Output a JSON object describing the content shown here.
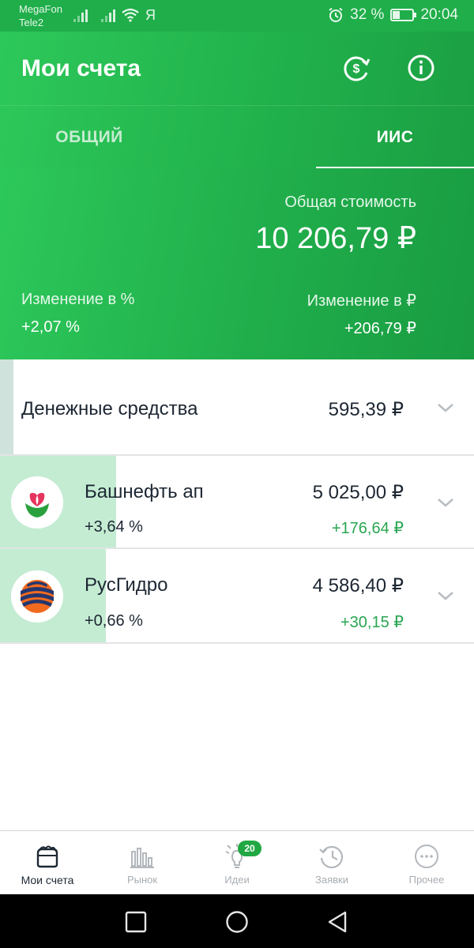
{
  "status_bar": {
    "carrier_1": "MegaFon",
    "carrier_2": "Tele2",
    "extra_icon_text": "Я",
    "battery": "32 %",
    "battery_level": 0.32,
    "time": "20:04"
  },
  "header": {
    "title": "Мои счета",
    "icons": [
      "currency-exchange-icon",
      "info-icon"
    ]
  },
  "tabs": [
    {
      "label": "ОБЩИЙ",
      "active": false
    },
    {
      "label": "ИИС",
      "active": true
    }
  ],
  "summary": {
    "total_label": "Общая стоимость",
    "total_value": "10 206,79 ₽",
    "change_pct_label": "Изменение в  %",
    "change_pct_value": "+2,07  %",
    "change_rub_label": "Изменение в ₽",
    "change_rub_value": "+206,79 ₽"
  },
  "cash": {
    "label": "Денежные средства",
    "value": "595,39 ₽"
  },
  "holdings": [
    {
      "name": "Башнефть ап",
      "value": "5 025,00 ₽",
      "change_pct": "+3,64  %",
      "change_rub": "+176,64 ₽",
      "icon": "bashneft-logo-icon"
    },
    {
      "name": "РусГидро",
      "value": "4 586,40 ₽",
      "change_pct": "+0,66  %",
      "change_rub": "+30,15 ₽",
      "icon": "rushydro-logo-icon"
    }
  ],
  "bottom_nav": [
    {
      "label": "Мои счета",
      "icon": "wallet-icon",
      "active": true
    },
    {
      "label": "Рынок",
      "icon": "market-chart-icon",
      "active": false
    },
    {
      "label": "Идеи",
      "icon": "lightbulb-icon",
      "active": false,
      "badge": "20"
    },
    {
      "label": "Заявки",
      "icon": "history-icon",
      "active": false
    },
    {
      "label": "Прочее",
      "icon": "more-icon",
      "active": false
    }
  ],
  "colors": {
    "brand_green": "#21b24c",
    "positive_change": "#29a651",
    "holding_bar": "#c4ecd3"
  }
}
